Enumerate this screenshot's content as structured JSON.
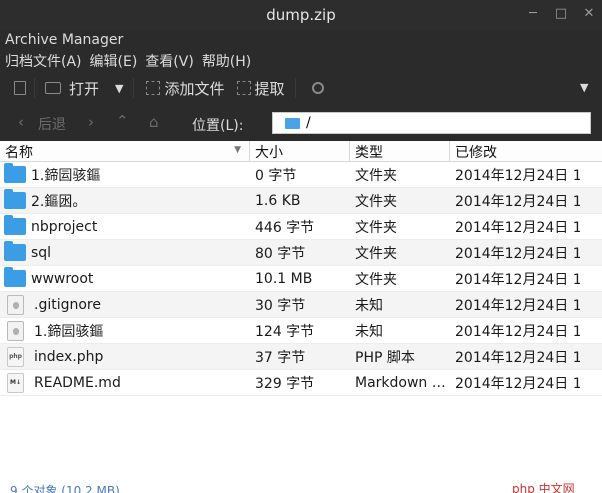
{
  "window": {
    "title": "dump.zip",
    "controls": [
      "─",
      "□",
      "✕"
    ]
  },
  "app": {
    "name": "Archive Manager"
  },
  "menubar": [
    "归档文件(A)",
    "编辑(E)",
    "查看(V)",
    "帮助(H)"
  ],
  "toolbar": {
    "open_label": "打开",
    "add_label": "添加文件",
    "extract_label": "提取"
  },
  "nav": {
    "back_label": "后退",
    "location_label": "位置(L):",
    "path": "/"
  },
  "table": {
    "headers": [
      "名称",
      "大小",
      "类型",
      "已修改"
    ],
    "rows": [
      {
        "name": "1.鍗囩骇鏂",
        "size": "0 字节",
        "type": "文件夹",
        "modified": "2014年12月24日 1…",
        "icon": "folder-icon"
      },
      {
        "name": "2.鏂囦。",
        "size": "1.6 KB",
        "type": "文件夹",
        "modified": "2014年12月24日 1…",
        "icon": "folder-icon"
      },
      {
        "name": "nbproject",
        "size": "446 字节",
        "type": "文件夹",
        "modified": "2014年12月24日 1…",
        "icon": "folder-icon"
      },
      {
        "name": "sql",
        "size": "80 字节",
        "type": "文件夹",
        "modified": "2014年12月24日 1…",
        "icon": "folder-icon"
      },
      {
        "name": "wwwroot",
        "size": "10.1 MB",
        "type": "文件夹",
        "modified": "2014年12月24日 1…",
        "icon": "folder-icon"
      },
      {
        "name": ".gitignore",
        "size": "30 字节",
        "type": "未知",
        "modified": "2014年12月24日 1…",
        "icon": "unknown-file-icon"
      },
      {
        "name": "1.鍗囩骇鏂",
        "size": "124 字节",
        "type": "未知",
        "modified": "2014年12月24日 1…",
        "icon": "unknown-file-icon"
      },
      {
        "name": "index.php",
        "size": "37 字节",
        "type": "PHP 脚本",
        "modified": "2014年12月24日 1…",
        "icon": "php-file-icon"
      },
      {
        "name": "README.md",
        "size": "329 字节",
        "type": "Markdown …",
        "modified": "2014年12月24日 1…",
        "icon": "markdown-file-icon"
      }
    ]
  },
  "status": {
    "text": "9 个对象 (10.2 MB)"
  },
  "watermark": {
    "text": "php 中文网"
  },
  "colors": {
    "accent_folder": "#3a9de6",
    "chrome_bg": "#2b2b2b",
    "table_bg": "#ffffff"
  }
}
